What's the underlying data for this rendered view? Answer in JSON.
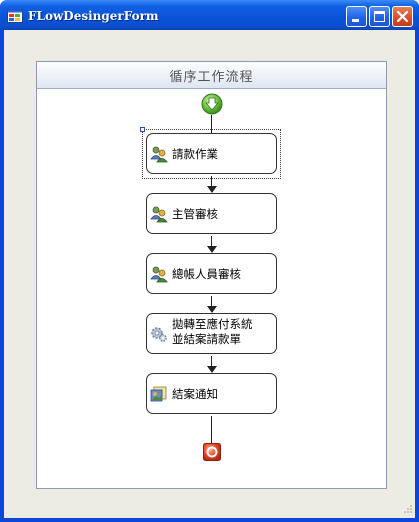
{
  "window": {
    "title": "FLowDesingerForm",
    "icons": {
      "app": "windows-form-icon",
      "minimize": "minimize-icon",
      "maximize": "maximize-icon",
      "close": "close-icon"
    }
  },
  "designer": {
    "title": "循序工作流程",
    "start_icon": "green-down-arrow-icon",
    "end_icon": "red-stop-icon",
    "activities": [
      {
        "label": "請款作業",
        "icon": "users-icon",
        "selected": true
      },
      {
        "label": "主管審核",
        "icon": "users-icon"
      },
      {
        "label": "總帳人員審核",
        "icon": "users-icon"
      },
      {
        "label_line1": "拋轉至應付系統",
        "label_line2": "並結案請款單",
        "icon": "gear-icon"
      },
      {
        "label": "結案通知",
        "icon": "notification-icon"
      }
    ]
  },
  "colors": {
    "titlebar": "#0a54d8",
    "window_bg": "#ecebe4",
    "close_button": "#d4512c",
    "designer_border": "#8c9ab5"
  }
}
